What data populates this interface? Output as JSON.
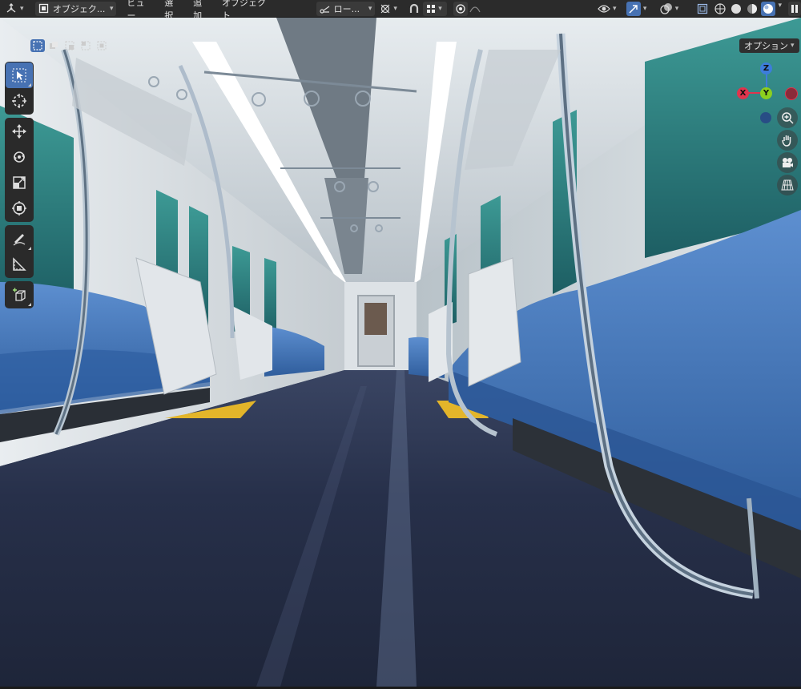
{
  "header": {
    "editor_type_icon": "3d-viewport-icon",
    "mode": {
      "icon": "object-mode-icon",
      "label": "オブジェク..."
    },
    "menus": [
      "ビュー",
      "選択",
      "追加",
      "オブジェクト"
    ],
    "transform_orientation": {
      "icon": "orientation-icon",
      "label": "ロー..."
    },
    "pivot_icon": "pivot-point-icon",
    "snap_icon": "snap-magnet-icon",
    "snap_target_icon": "snap-grid-icon",
    "proportional_icon": "proportional-edit-icon",
    "falloff_icon": "falloff-curve-icon",
    "visibility_icon": "eye-icon",
    "gizmo_icon": "gizmo-arrow-icon",
    "overlay_icon": "overlay-icon",
    "xray_icon": "xray-icon",
    "shading_modes": [
      "wireframe-shading-icon",
      "solid-shading-icon",
      "material-shading-icon",
      "rendered-shading-icon"
    ],
    "pause_icon": "pause-icon"
  },
  "select_modes": [
    "select-new-icon",
    "select-extend-icon",
    "select-subtract-icon",
    "select-invert-icon",
    "select-intersect-icon"
  ],
  "toolbar": {
    "tools": [
      {
        "name": "select-box-tool",
        "icon": "cursor-arrow-icon",
        "active": true
      },
      {
        "name": "cursor-tool",
        "icon": "3d-cursor-icon"
      },
      {
        "name": "move-tool",
        "icon": "move-arrows-icon"
      },
      {
        "name": "rotate-tool",
        "icon": "rotate-icon"
      },
      {
        "name": "scale-tool",
        "icon": "scale-icon"
      },
      {
        "name": "transform-tool",
        "icon": "transform-icon"
      },
      {
        "name": "annotate-tool",
        "icon": "annotate-pencil-icon"
      },
      {
        "name": "measure-tool",
        "icon": "measure-ruler-icon"
      },
      {
        "name": "add-cube-tool",
        "icon": "add-cube-icon"
      }
    ]
  },
  "options_label": "オプション",
  "gizmo": {
    "z": "Z",
    "x": "X",
    "y": "Y"
  },
  "nav_buttons": [
    "zoom-icon",
    "pan-hand-icon",
    "camera-icon",
    "perspective-grid-icon"
  ],
  "colors": {
    "accent": "#4772b3",
    "axis_x": "#e0344d",
    "axis_y": "#8ccf1f",
    "axis_z": "#3d7ddb",
    "seat": "#3f74b8",
    "floor": "#2a3350",
    "warning_strip": "#e3b52a"
  }
}
